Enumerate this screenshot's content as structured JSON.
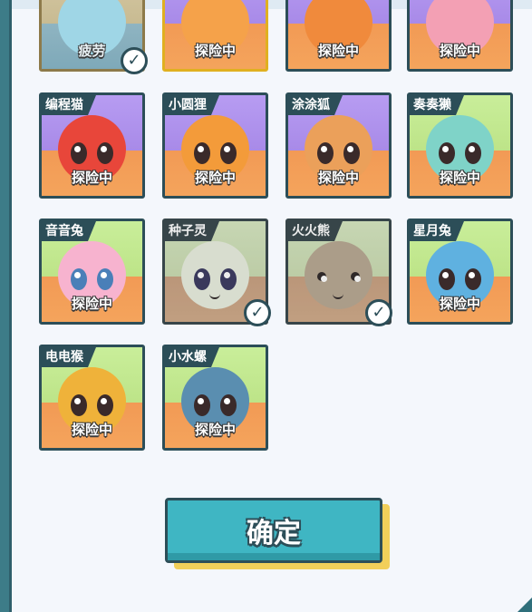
{
  "row0": [
    {
      "name": "",
      "status": "疲劳",
      "checked": true
    },
    {
      "name": "",
      "status": "探险中",
      "checked": false
    },
    {
      "name": "",
      "status": "探险中",
      "checked": false
    },
    {
      "name": "",
      "status": "探险中",
      "checked": false
    }
  ],
  "row1": [
    {
      "name": "编程猫",
      "status": "探险中"
    },
    {
      "name": "小圆狸",
      "status": "探险中"
    },
    {
      "name": "涂涂狐",
      "status": "探险中"
    },
    {
      "name": "奏奏獭",
      "status": "探险中"
    }
  ],
  "row2": [
    {
      "name": "音音兔",
      "status": "探险中"
    },
    {
      "name": "种子灵",
      "status": ""
    },
    {
      "name": "火火熊",
      "status": ""
    },
    {
      "name": "星月兔",
      "status": "探险中"
    }
  ],
  "row3": [
    {
      "name": "电电猴",
      "status": "探险中"
    },
    {
      "name": "小水螺",
      "status": "探险中"
    }
  ],
  "confirm_label": "确定",
  "colors": {
    "teal": "#3fb6c3",
    "dark": "#2c4e58",
    "purple_bg": "#b79cf2",
    "green_bg": "#c9ee9a",
    "orange": "#f29a55",
    "button_shadow": "#f1cf5a"
  }
}
